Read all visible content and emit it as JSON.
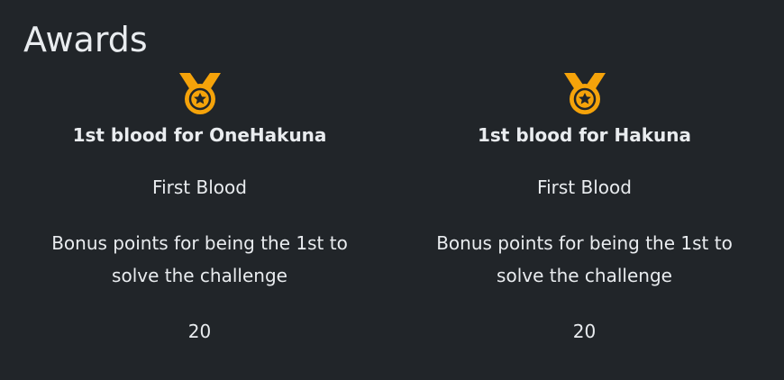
{
  "page": {
    "title": "Awards"
  },
  "colors": {
    "background": "#212529",
    "text": "#e9ecef",
    "medal": "#f5a30a",
    "medal_star": "#212529"
  },
  "awards": [
    {
      "icon": "medal-icon",
      "name": "1st blood for OneHakuna",
      "category": "First Blood",
      "description": "Bonus points for being the 1st to solve the challenge",
      "value": "20"
    },
    {
      "icon": "medal-icon",
      "name": "1st blood for Hakuna",
      "category": "First Blood",
      "description": "Bonus points for being the 1st to solve the challenge",
      "value": "20"
    }
  ]
}
